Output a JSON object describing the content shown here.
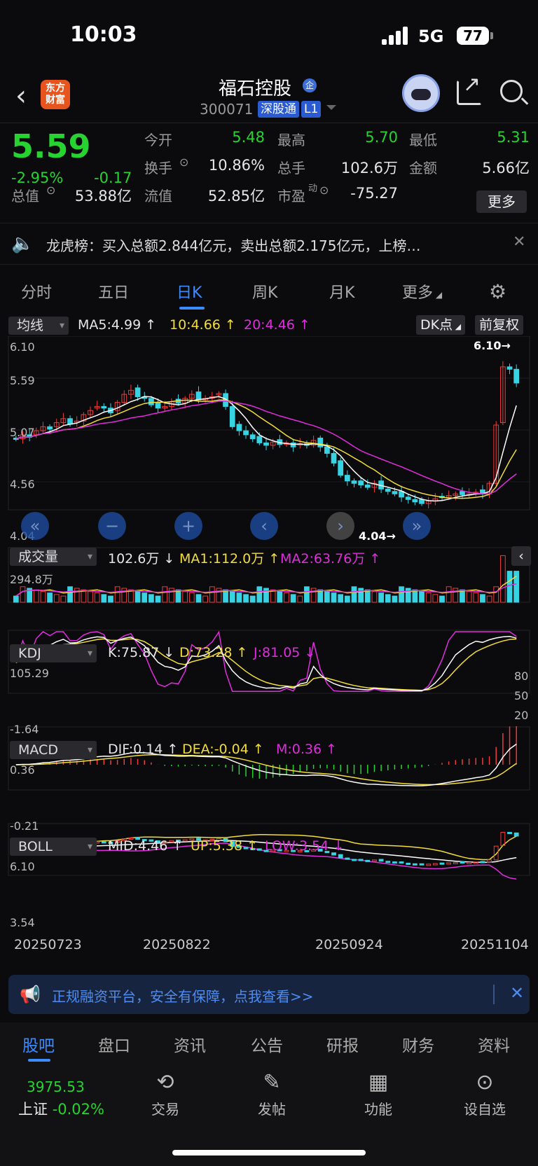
{
  "status": {
    "time": "10:03",
    "network": "5G",
    "battery": "77"
  },
  "header": {
    "brand": "东方\n财富",
    "title": "福石控股",
    "qi_badge": "企",
    "code": "300071",
    "tag1": "深股通",
    "tag2": "L1"
  },
  "quote": {
    "price": "5.59",
    "pct": "-2.95%",
    "change": "-0.17",
    "rows": [
      {
        "l1": "今开",
        "v1": "5.48",
        "l2": "最高",
        "v2": "5.70",
        "l3": "最低",
        "v3": "5.31"
      },
      {
        "l1": "换手",
        "v1": "10.86%",
        "l2": "总手",
        "v2": "102.6万",
        "l3": "金额",
        "v3": "5.66亿"
      },
      {
        "l1": "总值",
        "v1": "53.88亿",
        "l2": "流值",
        "v2": "52.85亿",
        "l3": "市盈",
        "v3": "-75.27"
      }
    ],
    "dyn_label": "动",
    "more": "更多"
  },
  "longhu": {
    "text": "龙虎榜：买入总额2.844亿元，卖出总额2.175亿元，上榜…"
  },
  "tabs": [
    "分时",
    "五日",
    "日K",
    "周K",
    "月K",
    "更多"
  ],
  "ma": {
    "select": "均线",
    "ma5": "MA5:4.99",
    "ma10": "10:4.66",
    "ma20": "20:4.46",
    "dk": "DK点",
    "fq": "前复权"
  },
  "kaxis": [
    "6.10",
    "5.59",
    "5.07",
    "4.56",
    "4.04"
  ],
  "k_annot": {
    "high": "6.10",
    "low": "4.04"
  },
  "vol": {
    "select": "成交量",
    "v": "102.6万",
    "ma1": "MA1:112.0万",
    "ma2": "MA2:63.76万",
    "top": "294.8万"
  },
  "kdj": {
    "select": "KDJ",
    "k": "K:75.87",
    "d": "D:73.28",
    "j": "J:81.05",
    "top": "105.29",
    "bottom": "-1.64",
    "l80": "80",
    "l50": "50",
    "l20": "20"
  },
  "macd": {
    "select": "MACD",
    "dif": "DIF:0.14",
    "dea": "DEA:-0.04",
    "m": "M:0.36",
    "top": "0.36",
    "bottom": "-0.21"
  },
  "boll": {
    "select": "BOLL",
    "mid": "MID:4.46",
    "up": "UP:5.38",
    "low": "LOW:3.54",
    "top": "6.10",
    "bottom": "3.54"
  },
  "dates": [
    "20250723",
    "20250822",
    "20250924",
    "20251104"
  ],
  "ad": {
    "text": "正规融资平台，安全有保障，点我查看>>"
  },
  "bottom_tabs": [
    "股吧",
    "盘口",
    "资讯",
    "公告",
    "研报",
    "财务",
    "资料"
  ],
  "index": {
    "value": "3975.53",
    "name": "上证",
    "pct": "-0.02%"
  },
  "dock": [
    "交易",
    "发帖",
    "功能",
    "设自选"
  ],
  "colors": {
    "up": "#ef3b3b",
    "down": "#37d3e3",
    "fall": "#27d331",
    "ma5": "#ffffff",
    "ma10": "#f2dd3a",
    "ma20": "#e02ddf",
    "accent": "#3b8cff"
  },
  "chart_data": {
    "type": "candlestick",
    "y_range": [
      4.04,
      6.1
    ],
    "closes": [
      4.9,
      4.95,
      4.92,
      5.0,
      5.05,
      5.02,
      5.1,
      5.15,
      5.08,
      5.12,
      5.2,
      5.25,
      5.3,
      5.28,
      5.22,
      5.35,
      5.45,
      5.5,
      5.42,
      5.4,
      5.32,
      5.28,
      5.3,
      5.36,
      5.34,
      5.4,
      5.45,
      5.38,
      5.4,
      5.42,
      5.46,
      5.3,
      5.05,
      5.0,
      4.95,
      4.9,
      4.85,
      4.82,
      4.86,
      4.83,
      4.85,
      4.8,
      4.84,
      4.82,
      4.88,
      4.8,
      4.72,
      4.6,
      4.45,
      4.38,
      4.35,
      4.33,
      4.3,
      4.35,
      4.28,
      4.25,
      4.22,
      4.18,
      4.15,
      4.12,
      4.1,
      4.13,
      4.16,
      4.18,
      4.2,
      4.22,
      4.21,
      4.22,
      4.24,
      4.22,
      4.35,
      5.07,
      5.79,
      5.76,
      5.59
    ]
  }
}
